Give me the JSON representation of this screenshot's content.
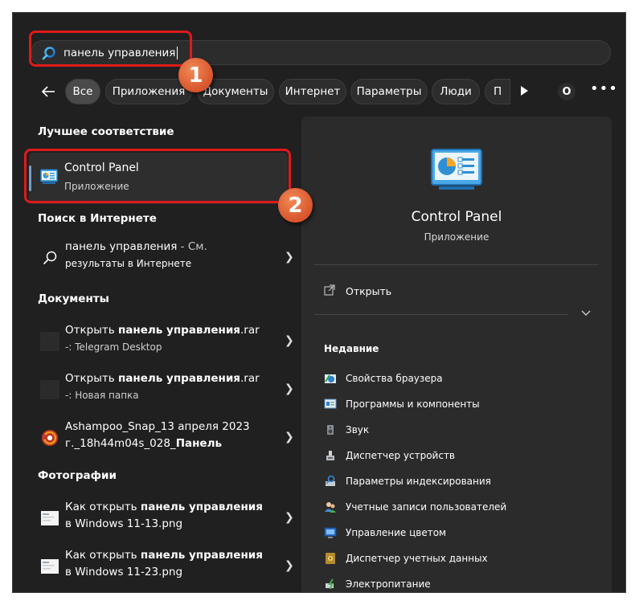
{
  "search": {
    "query": "панель управления"
  },
  "badges": {
    "one": "1",
    "two": "2"
  },
  "filters": {
    "chips": [
      "Все",
      "Приложения",
      "Документы",
      "Интернет",
      "Параметры",
      "Люди",
      "П"
    ],
    "avatar_letter": "O",
    "more": "•••"
  },
  "sections": {
    "best_match": "Лучшее соответствие",
    "web": "Поиск в Интернете",
    "documents": "Документы",
    "photos": "Фотографии"
  },
  "best_match": {
    "title": "Control Panel",
    "subtitle": "Приложение"
  },
  "web_result": {
    "query": "панель управления",
    "suffix": " - См.",
    "line2": "результаты в Интернете"
  },
  "documents": [
    {
      "prefix": "Открыть ",
      "bold": "панель управления",
      "suffix": ".rar",
      "sub": "-: Telegram Desktop"
    },
    {
      "prefix": "Открыть ",
      "bold": "панель управления",
      "suffix": ".rar",
      "sub": "-: Новая папка"
    },
    {
      "line1": "Ashampoo_Snap_13 апреля 2023",
      "line2_prefix": "г._18h44m04s_028_",
      "line2_bold": "Панель"
    }
  ],
  "photos": [
    {
      "prefix": "Как открыть ",
      "bold": "панель управления",
      "line2": "в Windows 11-13.png"
    },
    {
      "prefix": "Как открыть ",
      "bold": "панель управления",
      "line2": "в Windows 11-23.png"
    }
  ],
  "details": {
    "name": "Control Panel",
    "type": "Приложение",
    "open_label": "Открыть",
    "recent_title": "Недавние",
    "recent": [
      "Свойства браузера",
      "Программы и компоненты",
      "Звук",
      "Диспетчер устройств",
      "Параметры индексирования",
      "Учетные записи пользователей",
      "Управление цветом",
      "Диспетчер учетных данных",
      "Электропитание"
    ]
  },
  "colors": {
    "panel_bg": "#202020",
    "annotation_red": "#e01a1a",
    "badge_orange": "#e0653a"
  }
}
